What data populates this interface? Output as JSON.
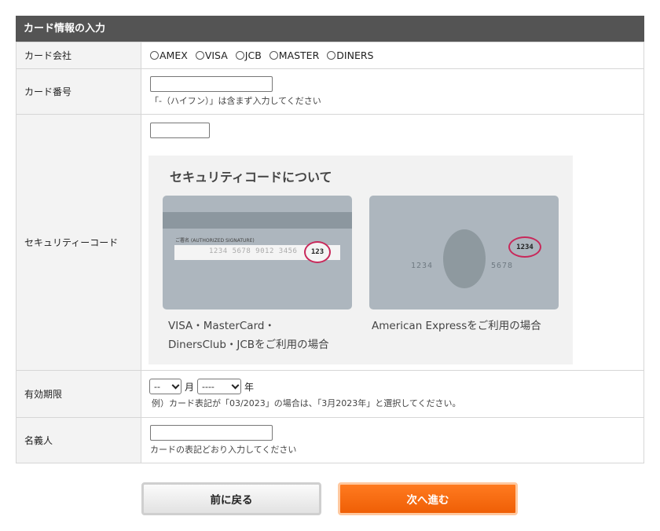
{
  "section_title": "カード情報の入力",
  "rows": {
    "company": {
      "label": "カード会社",
      "options": [
        "AMEX",
        "VISA",
        "JCB",
        "MASTER",
        "DINERS"
      ]
    },
    "number": {
      "label": "カード番号",
      "value": "",
      "hint": "「-（ハイフン）」は含まず入力してください"
    },
    "security": {
      "label": "セキュリティーコード",
      "value": "",
      "info": {
        "title": "セキュリティコードについて",
        "card_left": {
          "signature_label": "ご署名 (AUTHORIZED SIGNATURE)",
          "signature_number": "1234 5678 9012 3456",
          "code": "123",
          "caption_line1": "VISA・MasterCard・",
          "caption_line2": "DinersClub・JCBをご利用の場合"
        },
        "card_right": {
          "code": "1234",
          "num_left": "1234",
          "num_right": "5678",
          "caption": "American Expressをご利用の場合"
        }
      }
    },
    "expiry": {
      "label": "有効期限",
      "month_value": "--",
      "month_unit": "月",
      "year_value": "----",
      "year_unit": "年",
      "hint": "例）カード表記が「03/2023」の場合は、「3月2023年」と選択してください。"
    },
    "holder": {
      "label": "名義人",
      "value": "",
      "hint": "カードの表記どおり入力してください"
    }
  },
  "buttons": {
    "back": "前に戻る",
    "next": "次へ進む"
  },
  "colors": {
    "header_bg": "#545454",
    "label_bg": "#f3f3f3",
    "next_button": "#ef5f06",
    "cvv_ring": "#c8285a"
  }
}
